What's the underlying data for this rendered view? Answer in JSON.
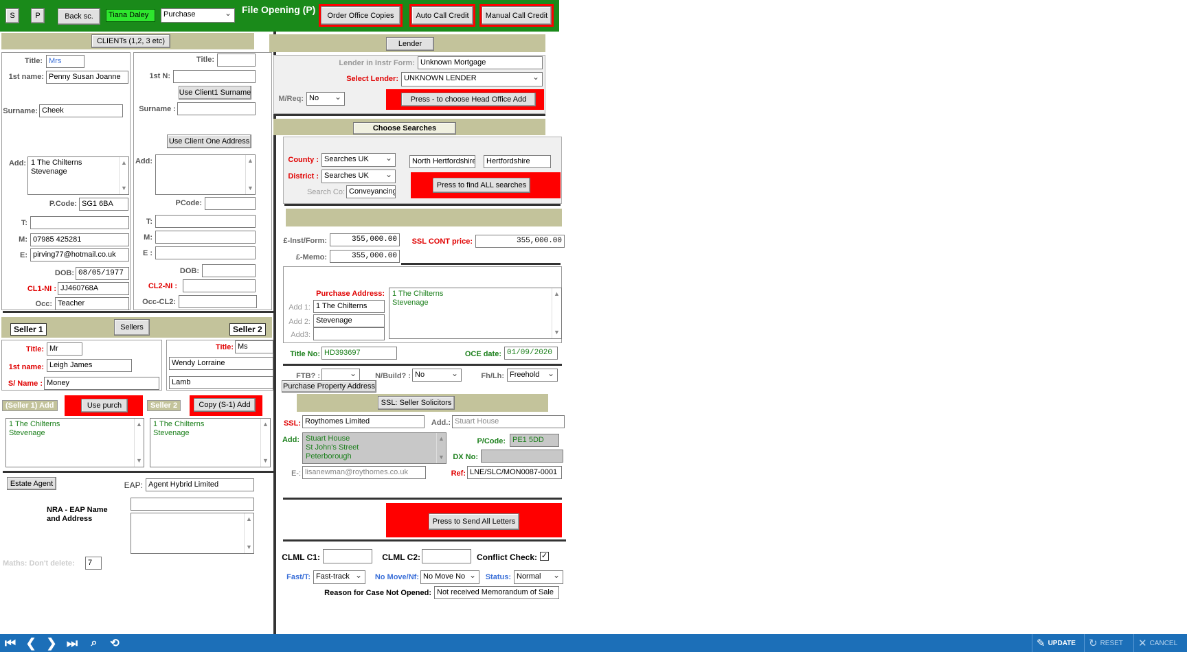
{
  "toolbar": {
    "s_label": "S",
    "p_label": "P",
    "back_label": "Back sc.",
    "user_name": "Tiana Daley",
    "transaction_type": "Purchase",
    "title": "File Opening (P)",
    "order_office_copies": "Order Office Copies",
    "auto_call_credit": "Auto Call Credit",
    "manual_call_credit": "Manual Call Credit"
  },
  "clients": {
    "header": "CLIENTs (1,2, 3 etc)",
    "c1": {
      "title_label": "Title:",
      "title": "Mrs",
      "first_label": "1st name:",
      "first": "Penny Susan Joanne",
      "surname_label": "Surname:",
      "surname": "Cheek",
      "add_label": "Add:",
      "address": "1 The Chilterns\nStevenage",
      "pcode_label": "P.Code:",
      "pcode": "SG1 6BA",
      "t_label": "T:",
      "t": "",
      "m_label": "M:",
      "m": "07985 425281",
      "e_label": "E:",
      "e": "pirving77@hotmail.co.uk",
      "dob_label": "DOB:",
      "dob": "08/05/1977",
      "ni_label": "CL1-NI :",
      "ni": "JJ460768A",
      "occ_label": "Occ:",
      "occ": "Teacher"
    },
    "c2": {
      "title_label": "Title:",
      "title": "",
      "first_label": "1st N:",
      "first": "",
      "use_surname": "Use Client1 Surname",
      "surname_label": "Surname :",
      "surname": "",
      "use_address": "Use Client One Address",
      "add_label": "Add:",
      "address": "",
      "pcode_label": "PCode:",
      "pcode": "",
      "t_label": "T:",
      "m_label": "M:",
      "e_label": "E :",
      "dob_label": "DOB:",
      "ni_label": "CL2-NI :",
      "occ_label": "Occ-CL2:"
    }
  },
  "sellers": {
    "seller1_tag": "Seller 1",
    "sellers_button": "Sellers",
    "seller2_tag": "Seller 2",
    "s1": {
      "title_label": "Title:",
      "title": "Mr",
      "first_label": "1st name:",
      "first": "Leigh James",
      "surname_label": "S/ Name :",
      "surname": "Money"
    },
    "s2": {
      "title_label": "Title:",
      "title": "Ms",
      "first": "Wendy Lorraine",
      "surname": "Lamb"
    },
    "s1_add_tag": "(Seller 1) Add",
    "use_purch": "Use purch",
    "s2_tag": "Seller 2",
    "copy_s1": "Copy (S-1) Add",
    "s1_address": "1 The Chilterns\nStevenage",
    "s2_address": "1 The Chilterns\nStevenage"
  },
  "agent": {
    "estate_agent": "Estate Agent",
    "eap_label": "EAP:",
    "eap": "Agent Hybrid Limited",
    "nra_label": "NRA - EAP Name\nand Address",
    "maths_label": "Maths: Don't delete:",
    "maths": "7"
  },
  "lender": {
    "header": "Lender",
    "instr_label": "Lender in Instr Form:",
    "instr": "Unknown Mortgage",
    "select_label": "Select Lender:",
    "select": "UNKNOWN LENDER",
    "mreq_label": "M/Req:",
    "mreq": "No",
    "head_office": "Press - to choose Head Office Add"
  },
  "searches": {
    "header": "Choose Searches",
    "county_label": "County :",
    "county": "Searches UK",
    "district_label": "District :",
    "district": "Searches UK",
    "searchco_label": "Search Co:",
    "searchco": "Conveyancing",
    "district_name": "North Hertfordshire",
    "county_name": "Hertfordshire",
    "find_all": "Press to find ALL searches"
  },
  "prices": {
    "inst_label": "£-Inst/Form:",
    "inst": "355,000.00",
    "memo_label": "£-Memo:",
    "memo": "355,000.00",
    "ssl_label": "SSL CONT price:",
    "ssl": "355,000.00"
  },
  "purchase": {
    "address_label": "Purchase Address:",
    "add1_label": "Add 1:",
    "add1": "1 The Chilterns",
    "add2_label": "Add 2:",
    "add2": "Stevenage",
    "add3_label": "Add3:",
    "add3": "",
    "address": "1 The Chilterns\nStevenage",
    "title_no_label": "Title No:",
    "title_no": "HD393697",
    "oce_label": "OCE date:",
    "oce": "01/09/2020",
    "ftb_label": "FTB? :",
    "ftb": "",
    "nbuild_label": "N/Build? :",
    "nbuild": "No",
    "fhlh_label": "Fh/Lh:",
    "fhlh": "Freehold",
    "pp_address": "Purchase Property Address"
  },
  "ssl": {
    "header": "SSL: Seller Solicitors",
    "ssl_label": "SSL:",
    "ssl": "Roythomes Limited",
    "add_label": "Add.:",
    "add": "Stuart House",
    "addr_label": "Add:",
    "address": "Stuart House\nSt John's Street\nPeterborough",
    "pcode_label": "P/Code:",
    "pcode": "PE1 5DD",
    "dx_label": "DX No:",
    "dx": "",
    "e_label": "E-:",
    "e": "lisanewman@roythomes.co.uk",
    "ref_label": "Ref:",
    "ref": "LNE/SLC/MON0087-0001",
    "send_letters": "Press to Send All Letters"
  },
  "footer": {
    "clml1_label": "CLML C1:",
    "clml1": "",
    "clml2_label": "CLML C2:",
    "clml2": "",
    "conflict_label": "Conflict Check:",
    "conflict_mark": "✓",
    "fast_label": "Fast/T:",
    "fast": "Fast-track",
    "nomove_label": "No Move/Nf:",
    "nomove": "No Move No",
    "status_label": "Status:",
    "status": "Normal",
    "reason_label": "Reason for Case Not Opened:",
    "reason": "Not received Memorandum of Sale"
  },
  "bottombar": {
    "update": "UPDATE",
    "reset": "RESET",
    "cancel": "CANCEL"
  },
  "colors": {
    "top_green": "#1a8a1a",
    "accent_red": "#ff0000",
    "olive": "#c3c39b",
    "bottom_blue": "#1c6fb8"
  }
}
